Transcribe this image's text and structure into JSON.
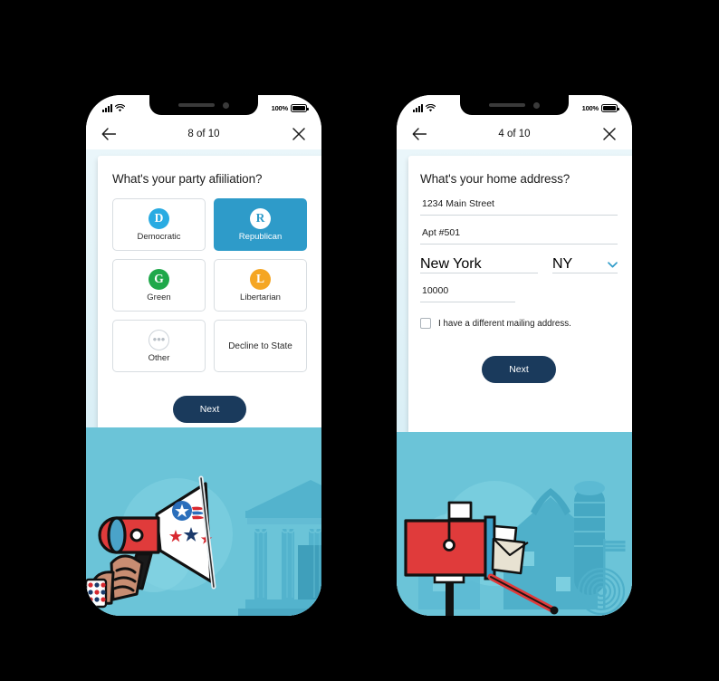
{
  "phones": [
    {
      "id": "party-affiliation",
      "status": {
        "battery_pct": "100%",
        "signal_icon": "signal-bars-icon",
        "wifi_icon": "wifi-icon",
        "battery_icon": "battery-icon"
      },
      "nav": {
        "back_icon": "back-arrow-icon",
        "title": "8 of 10",
        "close_icon": "close-icon"
      },
      "question": "What's your party afiiliation?",
      "options": [
        {
          "label": "Democratic",
          "badge": "D",
          "badge_class": "dem",
          "selected": false
        },
        {
          "label": "Republican",
          "badge": "R",
          "badge_class": "rep",
          "selected": true
        },
        {
          "label": "Green",
          "badge": "G",
          "badge_class": "grn",
          "selected": false
        },
        {
          "label": "Libertarian",
          "badge": "L",
          "badge_class": "lib",
          "selected": false
        },
        {
          "label": "Other",
          "badge": "•••",
          "badge_class": "oth",
          "selected": false
        },
        {
          "label": "Decline to State",
          "badge": null,
          "badge_class": null,
          "selected": false
        }
      ],
      "next_label": "Next",
      "illustration": "megaphone-hand-government-building"
    },
    {
      "id": "home-address",
      "status": {
        "battery_pct": "100%",
        "signal_icon": "signal-bars-icon",
        "wifi_icon": "wifi-icon",
        "battery_icon": "battery-icon"
      },
      "nav": {
        "back_icon": "back-arrow-icon",
        "title": "4 of 10",
        "close_icon": "close-icon"
      },
      "question": "What's your home address?",
      "fields": {
        "street": "1234 Main Street",
        "apt": "Apt #501",
        "city": "New York",
        "state": "NY",
        "state_chevron_icon": "chevron-down-icon",
        "zip": "10000"
      },
      "checkbox_label": "I have a different mailing address.",
      "checkbox_checked": false,
      "next_label": "Next",
      "illustration": "red-mailbox-envelopes-barn"
    }
  ],
  "colors": {
    "page_background": "#000000",
    "selected_tile": "#2e9bc9",
    "next_button": "#1a3a5c",
    "illustration_sky": "#6bc4d8",
    "accent_blue": "#29abe2",
    "green": "#1fa84a",
    "orange": "#f5a623",
    "mailbox_red": "#e03b3b"
  }
}
